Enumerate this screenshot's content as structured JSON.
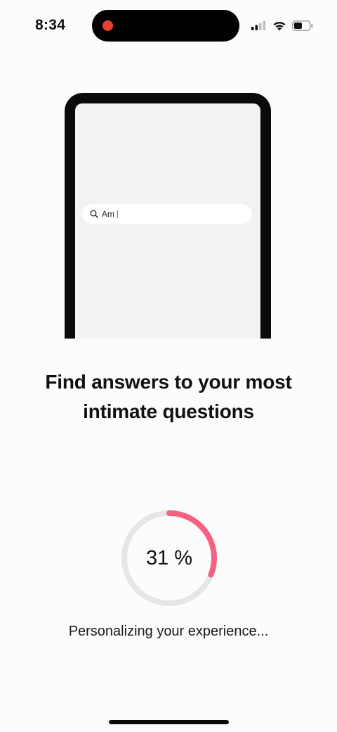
{
  "status_bar": {
    "time": "8:34",
    "recording_color": "#e8412f",
    "icons": [
      "cellular-signal-icon",
      "wifi-icon",
      "battery-icon"
    ]
  },
  "mockup": {
    "search_text": "Am"
  },
  "headline": {
    "line1": "Find answers to your most",
    "line2": "intimate questions"
  },
  "progress": {
    "value": 31,
    "label": "31 %",
    "track_color": "#e6e6e9",
    "fill_color": "#f7607f"
  },
  "status_text": "Personalizing your experience..."
}
